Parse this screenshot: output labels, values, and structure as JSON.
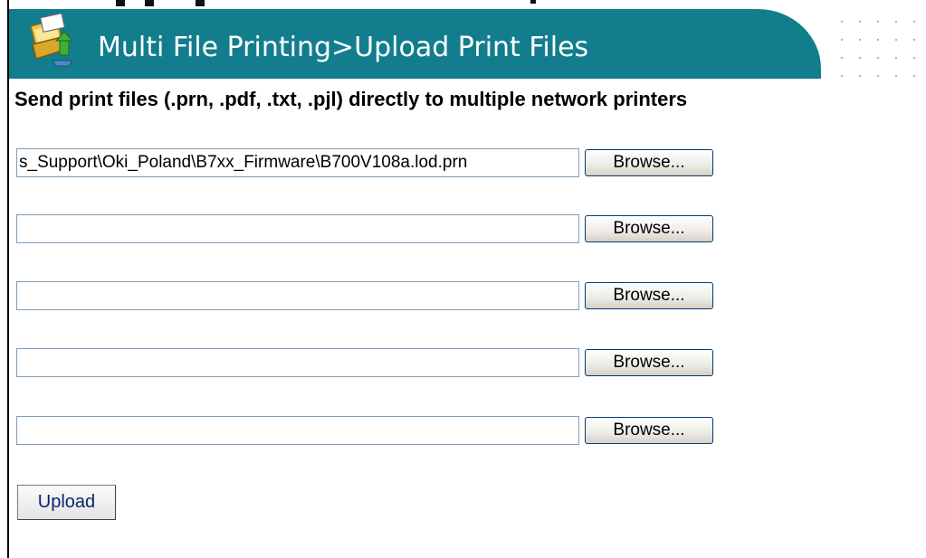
{
  "header": {
    "title": "Multi File Printing>Upload Print Files",
    "icon": "printer-upload-icon",
    "band_color": "#127d8d"
  },
  "description": "Send print files (.prn, .pdf, .txt, .pjl) directly to multiple network printers",
  "file_inputs": [
    {
      "value": "s_Support\\Oki_Poland\\B7xx_Firmware\\B700V108a.lod.prn",
      "button_label": "Browse..."
    },
    {
      "value": "",
      "button_label": "Browse..."
    },
    {
      "value": "",
      "button_label": "Browse..."
    },
    {
      "value": "",
      "button_label": "Browse..."
    },
    {
      "value": "",
      "button_label": "Browse..."
    }
  ],
  "upload_label": "Upload"
}
